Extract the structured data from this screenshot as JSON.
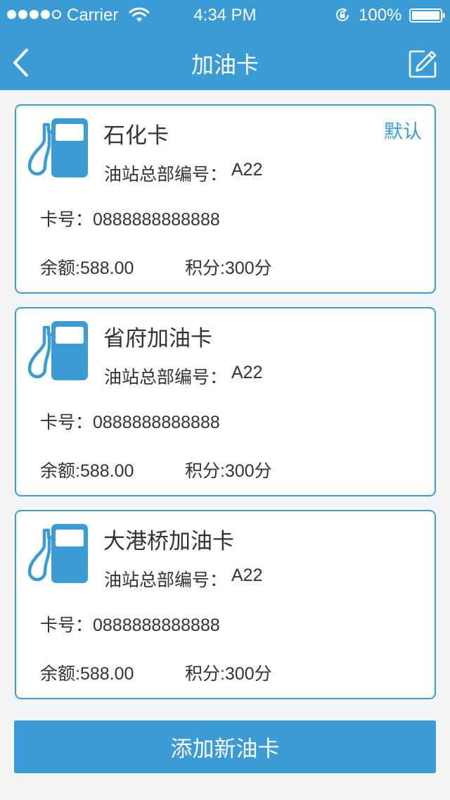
{
  "status_bar": {
    "carrier": "Carrier",
    "time": "4:34 PM",
    "battery": "100%",
    "signal_bars_filled": 4,
    "signal_bars_total": 5
  },
  "nav": {
    "title": "加油卡",
    "back_icon": "chevron-left-icon",
    "edit_icon": "edit-icon"
  },
  "theme": {
    "accent": "#3a9bd5",
    "background": "#f4f5f7",
    "text": "#333333"
  },
  "cards": [
    {
      "name": "石化卡",
      "default_label": "默认",
      "station_label": "油站总部编号：",
      "station_code": "A22",
      "card_number": "卡号：0888888888888",
      "balance": "余额:588.00",
      "points": "积分:300分"
    },
    {
      "name": "省府加油卡",
      "station_label": "油站总部编号：",
      "station_code": "A22",
      "card_number": "卡号：0888888888888",
      "balance": "余额:588.00",
      "points": "积分:300分"
    },
    {
      "name": "大港桥加油卡",
      "station_label": "油站总部编号：",
      "station_code": "A22",
      "card_number": "卡号：0888888888888",
      "balance": "余额:588.00",
      "points": "积分:300分"
    }
  ],
  "add_button": {
    "label": "添加新油卡"
  }
}
